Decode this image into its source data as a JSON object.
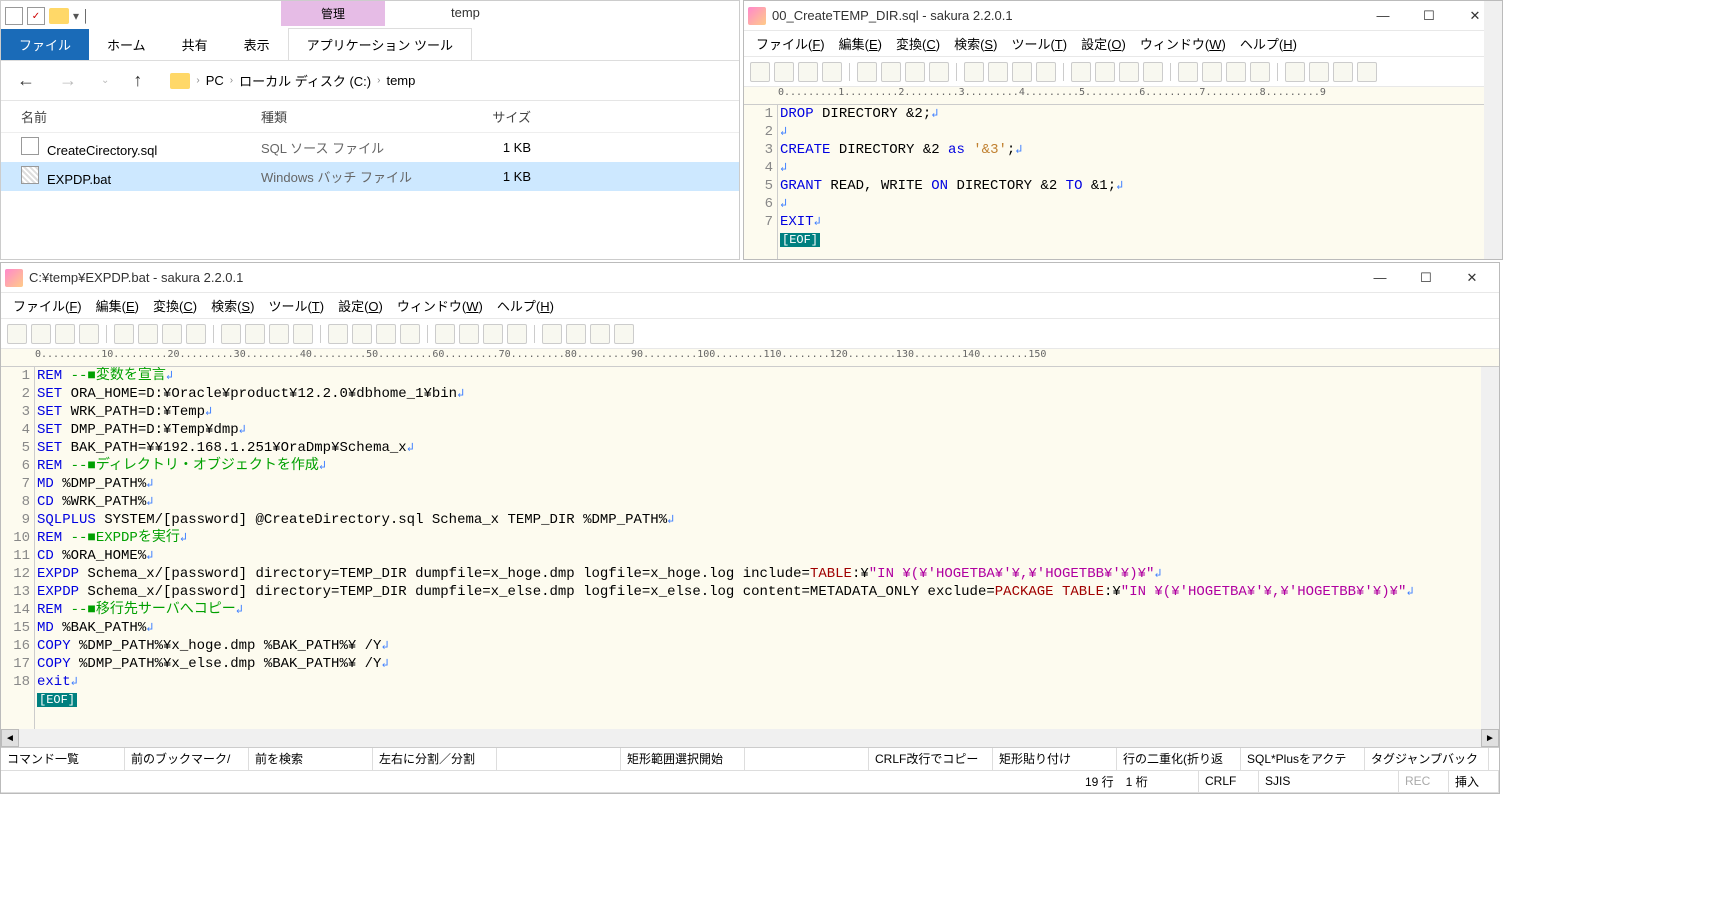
{
  "explorer": {
    "mgmt_label": "管理",
    "title": "temp",
    "tabs": {
      "file": "ファイル",
      "home": "ホーム",
      "share": "共有",
      "view": "表示",
      "apptools": "アプリケーション ツール"
    },
    "breadcrumb": {
      "pc": "PC",
      "drive": "ローカル ディスク (C:)",
      "folder": "temp"
    },
    "cols": {
      "name": "名前",
      "type": "種類",
      "size": "サイズ"
    },
    "rows": [
      {
        "name": "CreateCirectory.sql",
        "type": "SQL ソース ファイル",
        "size": "1 KB",
        "selected": false,
        "icon": "sql"
      },
      {
        "name": "EXPDP.bat",
        "type": "Windows バッチ ファイル",
        "size": "1 KB",
        "selected": true,
        "icon": "bat"
      }
    ]
  },
  "sakura_tr": {
    "title": "00_CreateTEMP_DIR.sql - sakura 2.2.0.1",
    "menus": [
      "ファイル(F)",
      "編集(E)",
      "変換(C)",
      "検索(S)",
      "ツール(T)",
      "設定(O)",
      "ウィンドウ(W)",
      "ヘルプ(H)"
    ],
    "lines": [
      [
        {
          "t": "DROP",
          "c": "c-blue"
        },
        {
          "t": " DIRECTORY &2;"
        },
        {
          "t": "↲",
          "c": "crlf"
        }
      ],
      [
        {
          "t": "↲",
          "c": "crlf"
        }
      ],
      [
        {
          "t": "CREATE",
          "c": "c-blue"
        },
        {
          "t": " DIRECTORY &2 "
        },
        {
          "t": "as",
          "c": "c-blue"
        },
        {
          "t": " "
        },
        {
          "t": "'&3'",
          "c": "c-orange"
        },
        {
          "t": ";"
        },
        {
          "t": "↲",
          "c": "crlf"
        }
      ],
      [
        {
          "t": "↲",
          "c": "crlf"
        }
      ],
      [
        {
          "t": "GRANT",
          "c": "c-blue"
        },
        {
          "t": " READ, WRITE "
        },
        {
          "t": "ON",
          "c": "c-blue"
        },
        {
          "t": " DIRECTORY &2 "
        },
        {
          "t": "TO",
          "c": "c-blue"
        },
        {
          "t": " &1;"
        },
        {
          "t": "↲",
          "c": "crlf"
        }
      ],
      [
        {
          "t": "↲",
          "c": "crlf"
        }
      ],
      [
        {
          "t": "EXIT",
          "c": "c-blue"
        },
        {
          "t": "↲",
          "c": "crlf"
        }
      ]
    ],
    "eof": "[EOF]"
  },
  "sakura_bot": {
    "title": "C:¥temp¥EXPDP.bat - sakura 2.2.0.1",
    "menus": [
      "ファイル(F)",
      "編集(E)",
      "変換(C)",
      "検索(S)",
      "ツール(T)",
      "設定(O)",
      "ウィンドウ(W)",
      "ヘルプ(H)"
    ],
    "lines": [
      [
        {
          "t": "REM",
          "c": "c-blue"
        },
        {
          "t": " "
        },
        {
          "t": "--■変数を宣言",
          "c": "c-green"
        },
        {
          "t": "↲",
          "c": "crlf"
        }
      ],
      [
        {
          "t": "SET",
          "c": "c-blue"
        },
        {
          "t": " ORA_HOME=D:¥Oracle¥product¥12.2.0¥dbhome_1¥bin"
        },
        {
          "t": "↲",
          "c": "crlf"
        }
      ],
      [
        {
          "t": "SET",
          "c": "c-blue"
        },
        {
          "t": " WRK_PATH=D:¥Temp"
        },
        {
          "t": "↲",
          "c": "crlf"
        }
      ],
      [
        {
          "t": "SET",
          "c": "c-blue"
        },
        {
          "t": " DMP_PATH=D:¥Temp¥dmp"
        },
        {
          "t": "↲",
          "c": "crlf"
        }
      ],
      [
        {
          "t": "SET",
          "c": "c-blue"
        },
        {
          "t": " BAK_PATH=¥¥192.168.1.251¥OraDmp¥Schema_x"
        },
        {
          "t": "↲",
          "c": "crlf"
        }
      ],
      [
        {
          "t": "REM",
          "c": "c-blue"
        },
        {
          "t": " "
        },
        {
          "t": "--■ディレクトリ・オブジェクトを作成",
          "c": "c-green"
        },
        {
          "t": "↲",
          "c": "crlf"
        }
      ],
      [
        {
          "t": "MD",
          "c": "c-blue"
        },
        {
          "t": " %DMP_PATH%"
        },
        {
          "t": "↲",
          "c": "crlf"
        }
      ],
      [
        {
          "t": "CD",
          "c": "c-blue"
        },
        {
          "t": " %WRK_PATH%"
        },
        {
          "t": "↲",
          "c": "crlf"
        }
      ],
      [
        {
          "t": "SQLPLUS",
          "c": "c-blue"
        },
        {
          "t": " SYSTEM/[password] @CreateDirectory.sql Schema_x TEMP_DIR %DMP_PATH%"
        },
        {
          "t": "↲",
          "c": "crlf"
        }
      ],
      [
        {
          "t": "REM",
          "c": "c-blue"
        },
        {
          "t": " "
        },
        {
          "t": "--■EXPDPを実行",
          "c": "c-green"
        },
        {
          "t": "↲",
          "c": "crlf"
        }
      ],
      [
        {
          "t": "CD",
          "c": "c-blue"
        },
        {
          "t": " %ORA_HOME%"
        },
        {
          "t": "↲",
          "c": "crlf"
        }
      ],
      [
        {
          "t": "EXPDP",
          "c": "c-blue"
        },
        {
          "t": " Schema_x/[password] directory=TEMP_DIR dumpfile=x_hoge.dmp logfile=x_hoge.log include="
        },
        {
          "t": "TABLE",
          "c": "c-red"
        },
        {
          "t": ":¥"
        },
        {
          "t": "\"IN ¥(¥'HOGETBA¥'¥,¥'HOGETBB¥'¥)¥\"",
          "c": "c-magenta"
        },
        {
          "t": "↲",
          "c": "crlf"
        }
      ],
      [
        {
          "t": "EXPDP",
          "c": "c-blue"
        },
        {
          "t": " Schema_x/[password] directory=TEMP_DIR dumpfile=x_else.dmp logfile=x_else.log content=METADATA_ONLY exclude="
        },
        {
          "t": "PACKAGE TABLE",
          "c": "c-red"
        },
        {
          "t": ":¥"
        },
        {
          "t": "\"IN ¥(¥'HOGETBA¥'¥,¥'HOGETBB¥'¥)¥\"",
          "c": "c-magenta"
        },
        {
          "t": "↲",
          "c": "crlf"
        }
      ],
      [
        {
          "t": "REM",
          "c": "c-blue"
        },
        {
          "t": " "
        },
        {
          "t": "--■移行先サーバへコピー",
          "c": "c-green"
        },
        {
          "t": "↲",
          "c": "crlf"
        }
      ],
      [
        {
          "t": "MD",
          "c": "c-blue"
        },
        {
          "t": " %BAK_PATH%"
        },
        {
          "t": "↲",
          "c": "crlf"
        }
      ],
      [
        {
          "t": "COPY",
          "c": "c-blue"
        },
        {
          "t": " %DMP_PATH%¥x_hoge.dmp %BAK_PATH%¥ /Y"
        },
        {
          "t": "↲",
          "c": "crlf"
        }
      ],
      [
        {
          "t": "COPY",
          "c": "c-blue"
        },
        {
          "t": " %DMP_PATH%¥x_else.dmp %BAK_PATH%¥ /Y"
        },
        {
          "t": "↲",
          "c": "crlf"
        }
      ],
      [
        {
          "t": "exit",
          "c": "c-blue"
        },
        {
          "t": "↲",
          "c": "crlf"
        }
      ]
    ],
    "eof": "[EOF]",
    "status1": [
      "コマンド一覧",
      "前のブックマーク/",
      "前を検索",
      "左右に分割／分割",
      "",
      "矩形範囲選択開始",
      "",
      "CRLF改行でコピー",
      "矩形貼り付け",
      "行の二重化(折り返",
      "SQL*Plusをアクテ",
      "タグジャンプバック"
    ],
    "status2": {
      "pos": "19 行　1 桁",
      "crlf": "CRLF",
      "enc": "SJIS",
      "rec": "REC",
      "ins": "挿入"
    }
  }
}
